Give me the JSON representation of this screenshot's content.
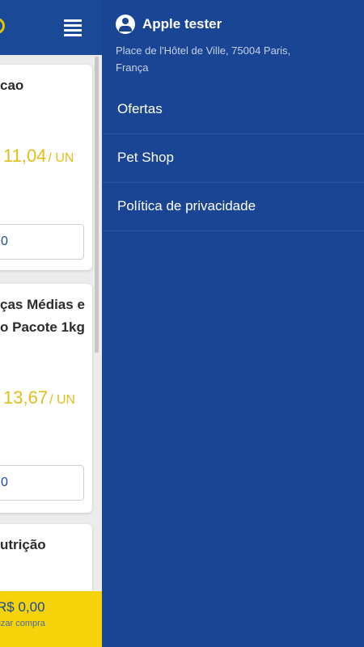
{
  "background": {
    "products": [
      {
        "name": "cao",
        "price": "11,04",
        "unit": "/ UN",
        "quantity": "0"
      },
      {
        "name": "ças Médias e\no Pacote 1kg",
        "price": "13,67",
        "unit": "/ UN",
        "quantity": "0"
      },
      {
        "name": "utrição"
      }
    ],
    "cart": {
      "total": "R$ 0,00",
      "subtitle": "lizar compra"
    }
  },
  "drawer": {
    "user_name": "Apple tester",
    "address": "Place de l'Hôtel de Ville, 75004 Paris, França",
    "menu": [
      {
        "label": "Ofertas"
      },
      {
        "label": "Pet Shop"
      },
      {
        "label": "Política de privacidade"
      }
    ]
  },
  "colors": {
    "primary": "#1a4595",
    "accent": "#f5d20a",
    "price": "#e3bd1a"
  },
  "icons": {
    "menu": "hamburger-menu-icon",
    "user": "account-circle-icon"
  }
}
